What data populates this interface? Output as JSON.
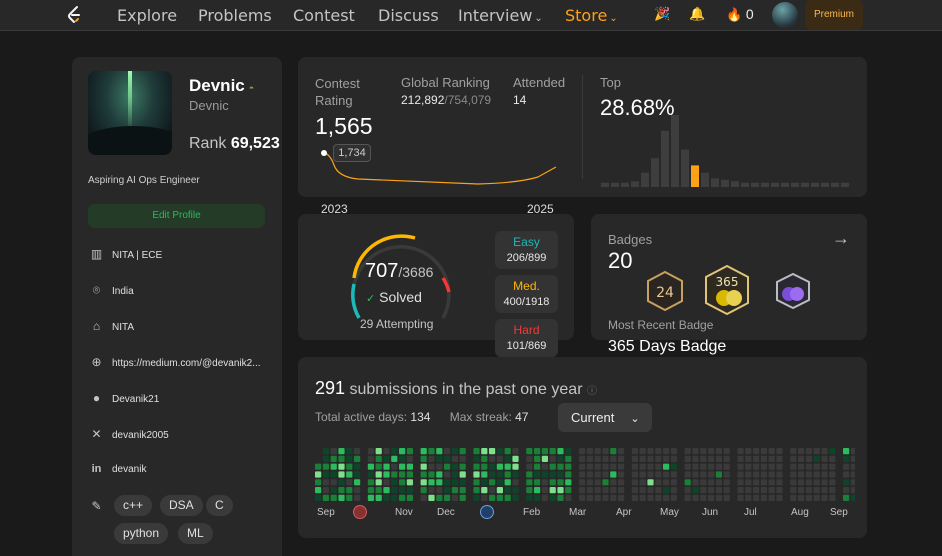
{
  "nav": {
    "links": [
      "Explore",
      "Problems",
      "Contest",
      "Discuss",
      "Interview",
      "Store"
    ],
    "streak_count": "0",
    "premium_label": "Premium"
  },
  "profile": {
    "name": "Devnic",
    "username": "Devnic",
    "rank_label": "Rank",
    "rank_value": "69,523",
    "bio": "Aspiring AI Ops Engineer",
    "edit_label": "Edit Profile",
    "info": [
      {
        "icon": "building-icon",
        "text": "NITA | ECE"
      },
      {
        "icon": "location-icon",
        "text": "India"
      },
      {
        "icon": "graduation-cap-icon",
        "text": "NITA"
      },
      {
        "icon": "globe-icon",
        "text": "https://medium.com/@devanik2..."
      },
      {
        "icon": "github-icon",
        "text": "Devanik21"
      },
      {
        "icon": "x-icon",
        "text": "devanik2005"
      },
      {
        "icon": "linkedin-icon",
        "text": "devanik"
      }
    ],
    "skills": [
      "c++",
      "DSA",
      "C",
      "python",
      "ML"
    ]
  },
  "contest": {
    "rating_label": "Contest\nRating",
    "rating_value": "1,565",
    "global_label": "Global Ranking",
    "global_value": "212,892",
    "global_total": "/754,079",
    "attended_label": "Attended",
    "attended_value": "14",
    "top_label": "Top",
    "top_value": "28.68%",
    "tooltip_value": "1,734",
    "year_start": "2023",
    "year_end": "2025",
    "histogram": [
      6,
      6,
      6,
      8,
      20,
      40,
      78,
      100,
      52,
      30,
      20,
      12,
      10,
      8,
      6,
      6,
      6,
      6,
      6,
      6,
      6,
      6,
      6,
      6,
      6
    ],
    "highlight_index": 9,
    "colors": {
      "line": "#ffa116",
      "bar": "#3e3e3e",
      "bar_highlight": "#ffa116"
    }
  },
  "solved": {
    "solved_count": "707",
    "total": "/3686",
    "solved_label": "Solved",
    "attempting": "29 Attempting",
    "easy": {
      "label": "Easy",
      "value": "206/899",
      "color": "#1cbaba"
    },
    "medium": {
      "label": "Med.",
      "value": "400/1918",
      "color": "#ffb700"
    },
    "hard": {
      "label": "Hard",
      "value": "101/869",
      "color": "#f63737"
    }
  },
  "badges": {
    "title": "Badges",
    "count": "20",
    "recent_label": "Most Recent Badge",
    "recent_name": "365 Days Badge"
  },
  "activity": {
    "count": "291",
    "text": "submissions in the past one year",
    "active_days_label": "Total active days:",
    "active_days": "134",
    "streak_label": "Max streak:",
    "streak": "47",
    "dropdown": "Current",
    "months": [
      "Sep",
      "Nov",
      "Dec",
      "Feb",
      "Mar",
      "Apr",
      "May",
      "Jun",
      "Jul",
      "Aug",
      "Sep"
    ]
  }
}
